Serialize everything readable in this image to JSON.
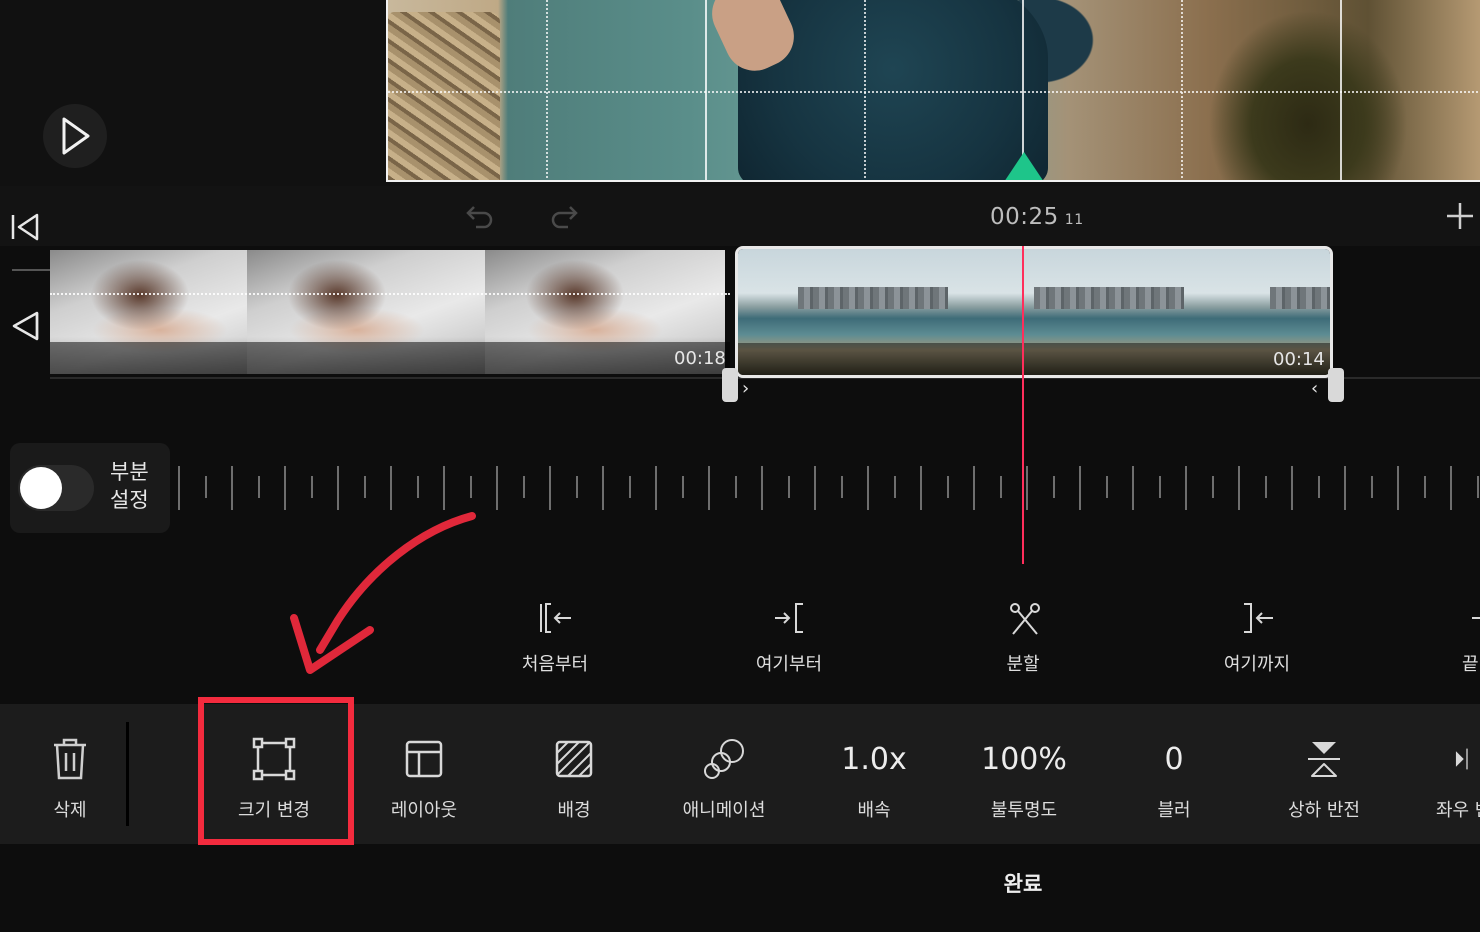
{
  "timeline": {
    "timecode": "00:25",
    "timecode_frames": "11"
  },
  "clips": [
    {
      "duration": "00:18"
    },
    {
      "duration": "00:14"
    }
  ],
  "partial": {
    "label_line1": "부분",
    "label_line2": "설정"
  },
  "trim_actions": [
    {
      "label": "처음부터",
      "icon": "trim-start-icon"
    },
    {
      "label": "여기부터",
      "icon": "trim-from-here-icon"
    },
    {
      "label": "분할",
      "icon": "scissors-icon"
    },
    {
      "label": "여기까지",
      "icon": "trim-to-here-icon"
    },
    {
      "label": "끝",
      "icon": "trim-end-icon"
    }
  ],
  "toolbar": {
    "delete": "삭제",
    "resize": "크기 변경",
    "layout": "레이아웃",
    "background": "배경",
    "animation": "애니메이션",
    "speed_value": "1.0x",
    "speed": "배속",
    "opacity_value": "100%",
    "opacity": "불투명도",
    "blur_value": "0",
    "blur": "블러",
    "flip_vertical": "상하 반전",
    "flip_horizontal": "좌우 반"
  },
  "done_label": "완료",
  "colors": {
    "playhead": "#ff2e5b",
    "highlight": "#f32b3e",
    "marker": "#1ec58a"
  }
}
